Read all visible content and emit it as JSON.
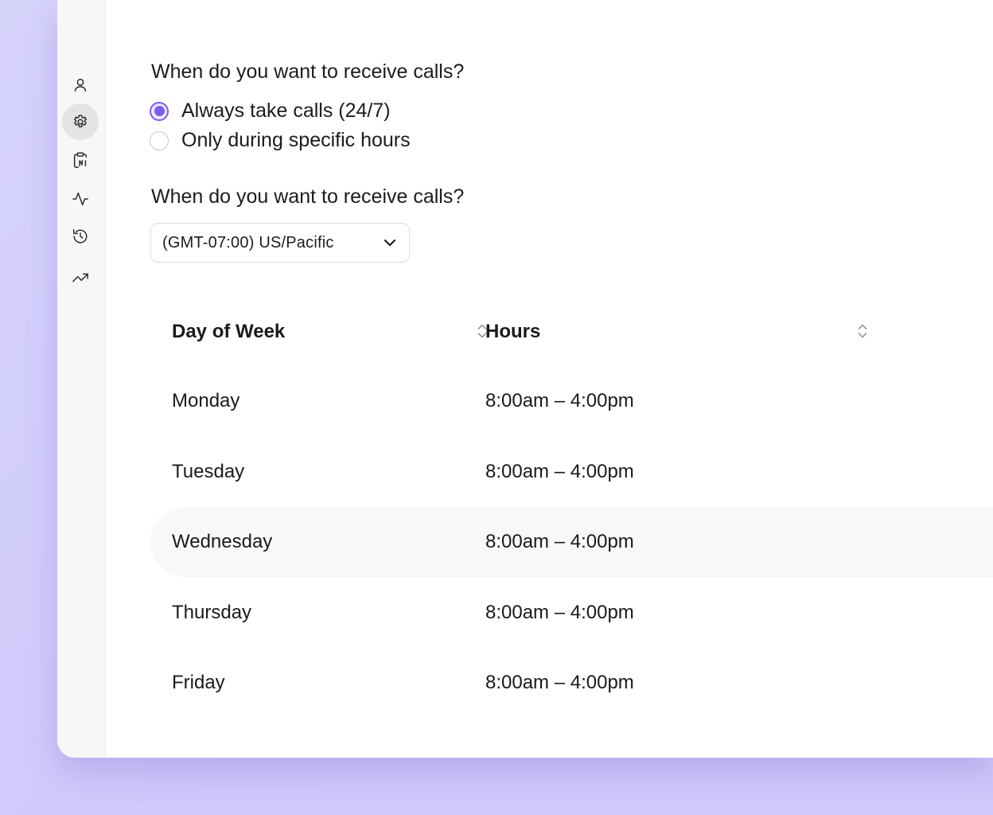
{
  "sidebar": {
    "items": [
      {
        "icon": "user-icon",
        "active": false
      },
      {
        "icon": "gear-icon",
        "active": true
      },
      {
        "icon": "clipboard-icon",
        "active": false
      },
      {
        "icon": "activity-icon",
        "active": false
      },
      {
        "icon": "history-icon",
        "active": false
      },
      {
        "icon": "trending-up-icon",
        "active": false
      }
    ]
  },
  "schedule": {
    "question": "When do you want to receive calls?",
    "options": [
      {
        "label": "Always take calls (24/7)",
        "selected": true
      },
      {
        "label": "Only during specific hours",
        "selected": false
      }
    ]
  },
  "timezone": {
    "question": "When do you want to receive calls?",
    "value": "(GMT-07:00) US/Pacific"
  },
  "table": {
    "headers": {
      "day": "Day of Week",
      "hours": "Hours"
    },
    "rows": [
      {
        "day": "Monday",
        "hours": "8:00am – 4:00pm"
      },
      {
        "day": "Tuesday",
        "hours": "8:00am – 4:00pm"
      },
      {
        "day": "Wednesday",
        "hours": "8:00am – 4:00pm",
        "highlighted": true
      },
      {
        "day": "Thursday",
        "hours": "8:00am – 4:00pm"
      },
      {
        "day": "Friday",
        "hours": "8:00am – 4:00pm"
      }
    ]
  },
  "colors": {
    "accent": "#7b5cf0",
    "background": "#d6d3fb",
    "row_highlight": "#f8f8f9"
  }
}
